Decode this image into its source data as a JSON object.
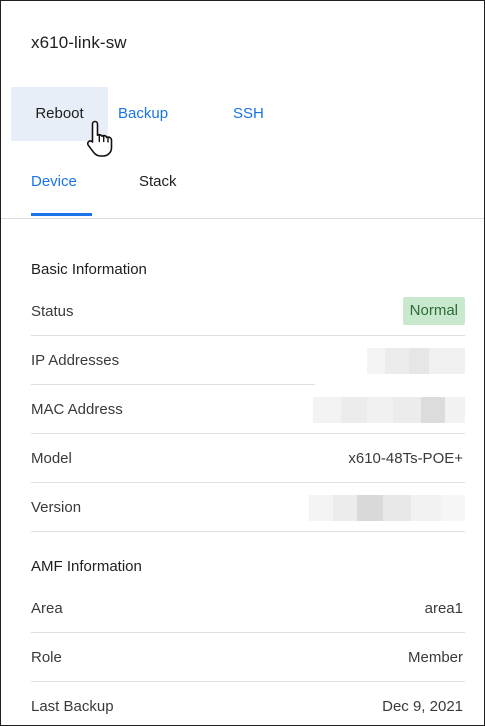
{
  "device": {
    "title": "x610-link-sw"
  },
  "actions": {
    "reboot": "Reboot",
    "backup": "Backup",
    "ssh": "SSH"
  },
  "tabs": {
    "device": "Device",
    "stack": "Stack",
    "active": "Device"
  },
  "basic_info": {
    "title": "Basic Information",
    "status_label": "Status",
    "status_value": "Normal",
    "ip_label": "IP Addresses",
    "mac_label": "MAC Address",
    "model_label": "Model",
    "model_value": "x610-48Ts-POE+",
    "version_label": "Version"
  },
  "amf_info": {
    "title": "AMF Information",
    "area_label": "Area",
    "area_value": "area1",
    "role_label": "Role",
    "role_value": "Member",
    "last_backup_label": "Last Backup",
    "last_backup_value": "Dec 9, 2021"
  },
  "colors": {
    "accent": "#1a73e8",
    "reboot_bg": "#e8eef7",
    "badge_bg": "#c9e9cf",
    "badge_text": "#2e6b36"
  },
  "icons": {
    "cursor": "hand-pointer-icon"
  }
}
